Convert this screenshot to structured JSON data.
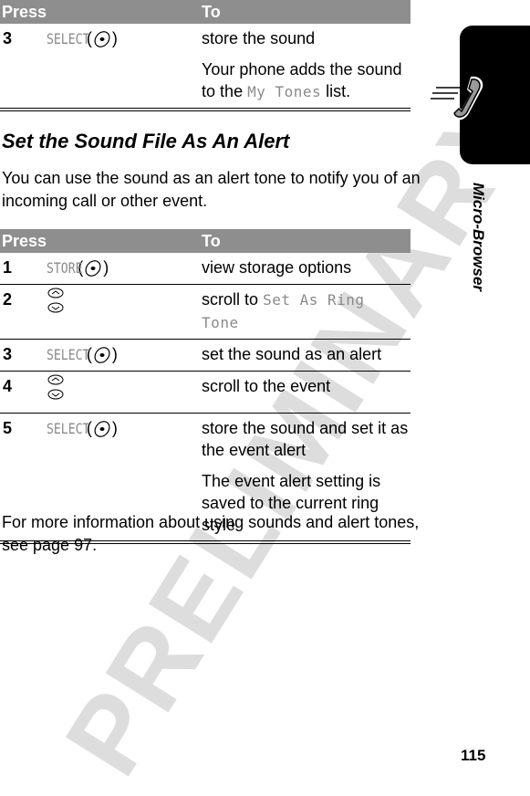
{
  "watermark": "PRELIMINARY",
  "table_top": {
    "headers": {
      "press": "Press",
      "to": "To"
    },
    "rows": [
      {
        "num": "3",
        "key": "SELECT",
        "key_icon": "center-select-key-icon",
        "desc": [
          "store the sound"
        ],
        "note_prefix": "Your phone adds the sound to the ",
        "note_disp": "My Tones",
        "note_suffix": " list."
      }
    ]
  },
  "section": {
    "title": "Set the Sound File As An Alert",
    "intro": "You can use the sound as an alert tone to notify you of an incoming call or other event."
  },
  "table_main": {
    "headers": {
      "press": "Press",
      "to": "To"
    },
    "rows": [
      {
        "num": "1",
        "key": "STORE",
        "key_icon": "center-select-key-icon",
        "desc": "view storage options"
      },
      {
        "num": "2",
        "key_icon": "scroll-up-down-icon",
        "desc_prefix": "scroll to ",
        "desc_disp": "Set As Ring Tone"
      },
      {
        "num": "3",
        "key": "SELECT",
        "key_icon": "center-select-key-icon",
        "desc": "set the sound as an alert"
      },
      {
        "num": "4",
        "key_icon": "scroll-up-down-icon",
        "desc": "scroll to the event"
      },
      {
        "num": "5",
        "key": "SELECT",
        "key_icon": "center-select-key-icon",
        "desc": "store the sound and set it as the event alert",
        "note": "The event alert setting is saved to the current ring style"
      }
    ]
  },
  "outro": "For more information about using sounds and alert tones, see page 97.",
  "side_tab": {
    "icon": "phone-handset-icon",
    "label": "Micro-Browser"
  },
  "page_number": "115"
}
